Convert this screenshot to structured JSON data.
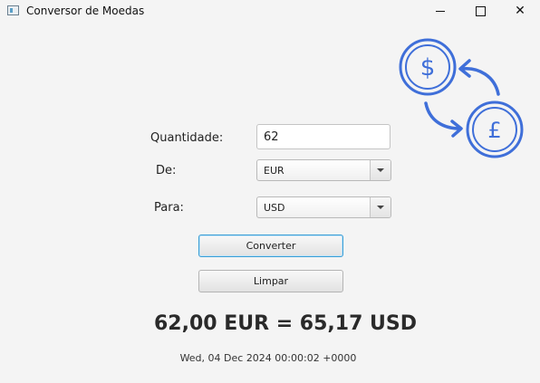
{
  "window": {
    "title": "Conversor de Moedas",
    "minimize_icon": "minimize-icon",
    "maximize_icon": "maximize-icon",
    "close_symbol": "✕"
  },
  "form": {
    "quantity_label": "Quantidade:",
    "quantity_value": "62",
    "from_label": "De:",
    "from_value": "EUR",
    "to_label": "Para:",
    "to_value": "USD"
  },
  "buttons": {
    "convert_label": "Converter",
    "clear_label": "Limpar"
  },
  "result": {
    "text": "62,00 EUR = 65,17 USD",
    "timestamp": "Wed, 04 Dec 2024 00:00:02 +0000"
  },
  "graphic": {
    "icon": "currency-exchange-icon",
    "accent_color": "#3f6fd9"
  }
}
